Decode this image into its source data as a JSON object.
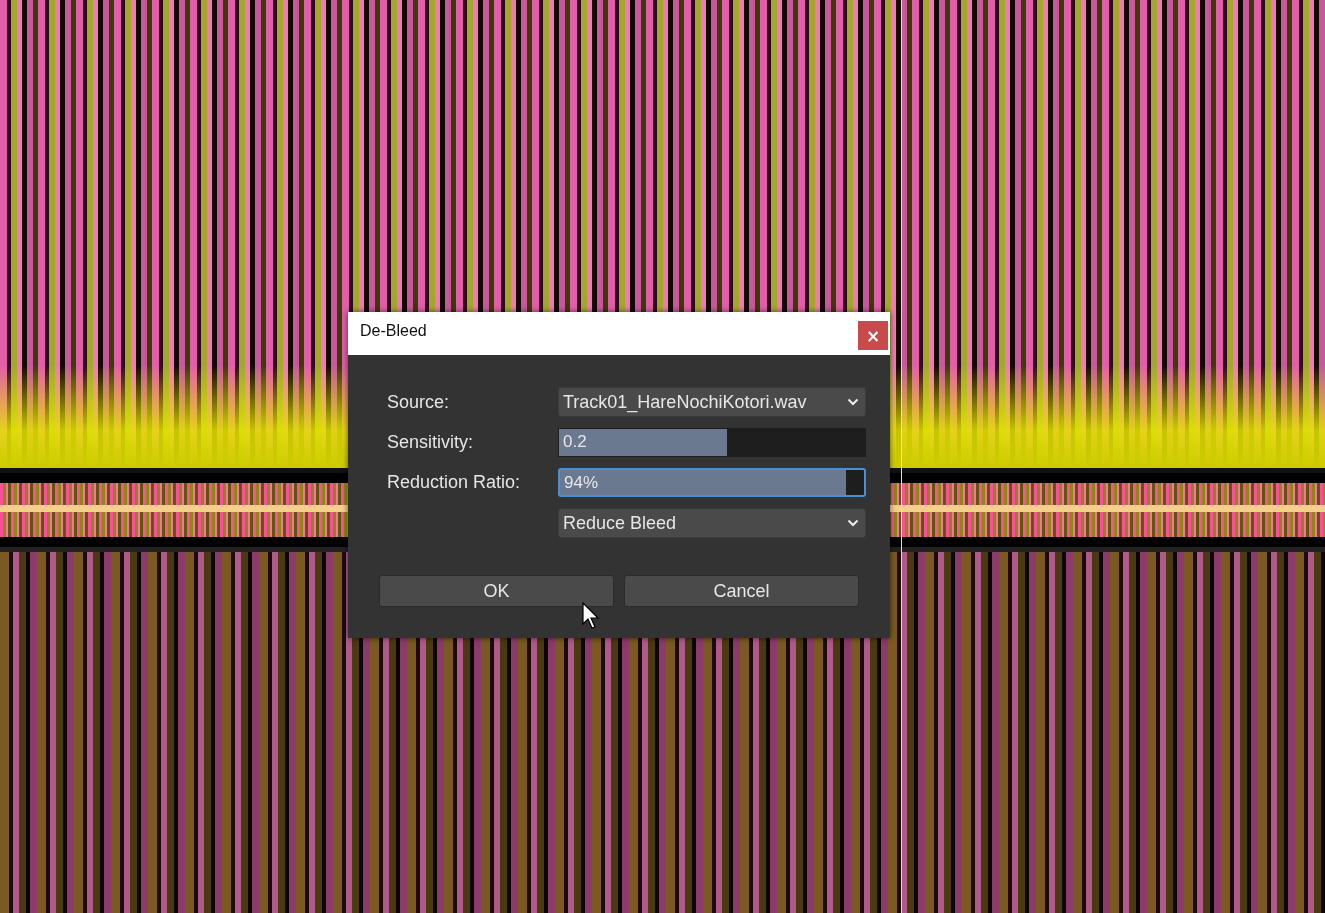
{
  "dialog": {
    "title": "De-Bleed",
    "close": "×",
    "fields": [
      {
        "kind": "select",
        "label": "Source:",
        "value": "Track01_HareNochiKotori.wav"
      },
      {
        "kind": "slider",
        "label": "Sensitivity:",
        "value": "0.2",
        "level": 0.55,
        "focused": false
      },
      {
        "kind": "slider",
        "label": "Reduction Ratio:",
        "value": "94%",
        "level": 0.94,
        "focused": true
      },
      {
        "kind": "select",
        "value": "Reduce Bleed"
      }
    ],
    "buttons": [
      {
        "label": "OK"
      },
      {
        "label": "Cancel"
      }
    ]
  }
}
